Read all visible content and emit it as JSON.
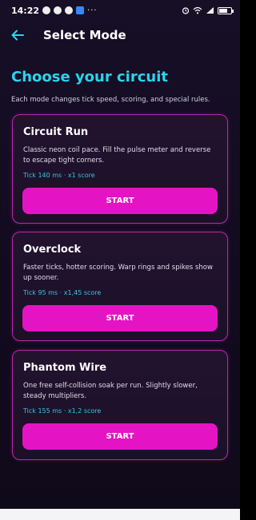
{
  "status_bar": {
    "time": "14:22",
    "more": "···",
    "battery_pct": 0.7
  },
  "app_bar": {
    "title": "Select Mode",
    "back_icon": "arrow-left-icon"
  },
  "headline": "Choose your circuit",
  "subtitle": "Each mode changes tick speed, scoring, and special rules.",
  "modes": [
    {
      "title": "Circuit Run",
      "description": "Classic neon coil pace. Fill the pulse meter and reverse to escape tight corners.",
      "meta": "Tick 140 ms · x1 score",
      "button": "START"
    },
    {
      "title": "Overclock",
      "description": "Faster ticks, hotter scoring. Warp rings and spikes show up sooner.",
      "meta": "Tick 95 ms · x1,45 score",
      "button": "START"
    },
    {
      "title": "Phantom Wire",
      "description": "One free self-collision soak per run. Slightly slower, steady multipliers.",
      "meta": "Tick 155 ms · x1,2 score",
      "button": "START"
    }
  ],
  "colors": {
    "accent_cyan": "#2ad4ee",
    "card_border": "#b52aa8",
    "button": "#e414c4",
    "background": "#150d22"
  }
}
